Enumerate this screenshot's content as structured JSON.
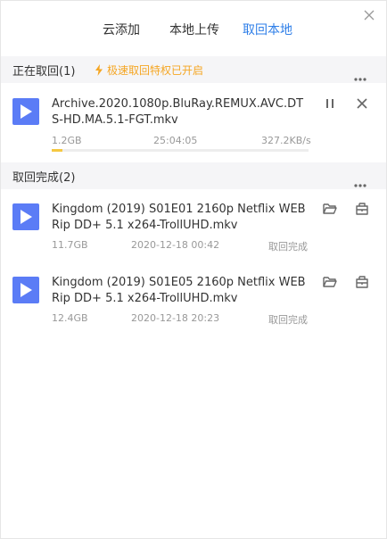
{
  "tabs": [
    {
      "label": "云添加",
      "active": false
    },
    {
      "label": "本地上传",
      "active": false
    },
    {
      "label": "取回本地",
      "active": true
    }
  ],
  "downloading": {
    "title": "正在取回(1)",
    "promo": "极速取回特权已开启",
    "items": [
      {
        "name": "Archive.2020.1080p.BluRay.REMUX.AVC.DTS-HD.MA.5.1-FGT.mkv",
        "size": "1.2GB",
        "time_left": "25:04:05",
        "speed": "327.2KB/s",
        "progress": 0.04
      }
    ]
  },
  "completed": {
    "title": "取回完成(2)",
    "items": [
      {
        "name": "Kingdom (2019) S01E01 2160p Netflix WEBRip DD+ 5.1 x264-TrollUHD.mkv",
        "size": "11.7GB",
        "date": "2020-12-18 00:42",
        "status": "取回完成"
      },
      {
        "name": "Kingdom (2019) S01E05 2160p Netflix WEBRip DD+ 5.1 x264-TrollUHD.mkv",
        "size": "12.4GB",
        "date": "2020-12-18 20:23",
        "status": "取回完成"
      }
    ]
  },
  "colors": {
    "accent": "#2f7fe8",
    "play_icon": "#5b7cf6",
    "promo": "#f5a623",
    "progress": "#f5c842"
  },
  "icons": [
    "close-icon",
    "lightning-icon",
    "more-icon",
    "play-icon",
    "pause-icon",
    "cancel-icon",
    "open-folder-icon",
    "locate-icon"
  ]
}
